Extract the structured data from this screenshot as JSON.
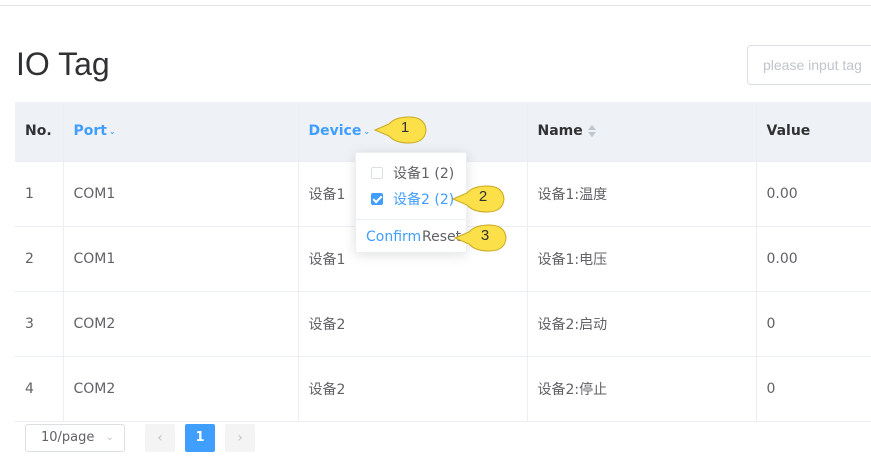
{
  "page": {
    "title": "IO Tag"
  },
  "search": {
    "placeholder": "please input tag"
  },
  "table": {
    "columns": {
      "no": "No.",
      "port": "Port",
      "device": "Device",
      "name": "Name",
      "value": "Value"
    },
    "rows": [
      {
        "no": "1",
        "port": "COM1",
        "device": "设备1",
        "name": "设备1:温度",
        "value": "0.00"
      },
      {
        "no": "2",
        "port": "COM1",
        "device": "设备1",
        "name": "设备1:电压",
        "value": "0.00"
      },
      {
        "no": "3",
        "port": "COM2",
        "device": "设备2",
        "name": "设备2:启动",
        "value": "0"
      },
      {
        "no": "4",
        "port": "COM2",
        "device": "设备2",
        "name": "设备2:停止",
        "value": "0"
      }
    ]
  },
  "filter_popover": {
    "options": [
      {
        "label": "设备1 (2)",
        "checked": false
      },
      {
        "label": "设备2 (2)",
        "checked": true
      }
    ],
    "confirm_label": "Confirm",
    "reset_label": "Reset"
  },
  "callouts": [
    "1",
    "2",
    "3"
  ],
  "colors": {
    "accent": "#409eff",
    "callout_fill": "#fce04a",
    "header_bg": "#eef1f6"
  },
  "pagination": {
    "page_size": "10/page",
    "current_page": "1",
    "prev_icon": "‹",
    "next_icon": "›",
    "dropdown_icon": "⌄"
  }
}
